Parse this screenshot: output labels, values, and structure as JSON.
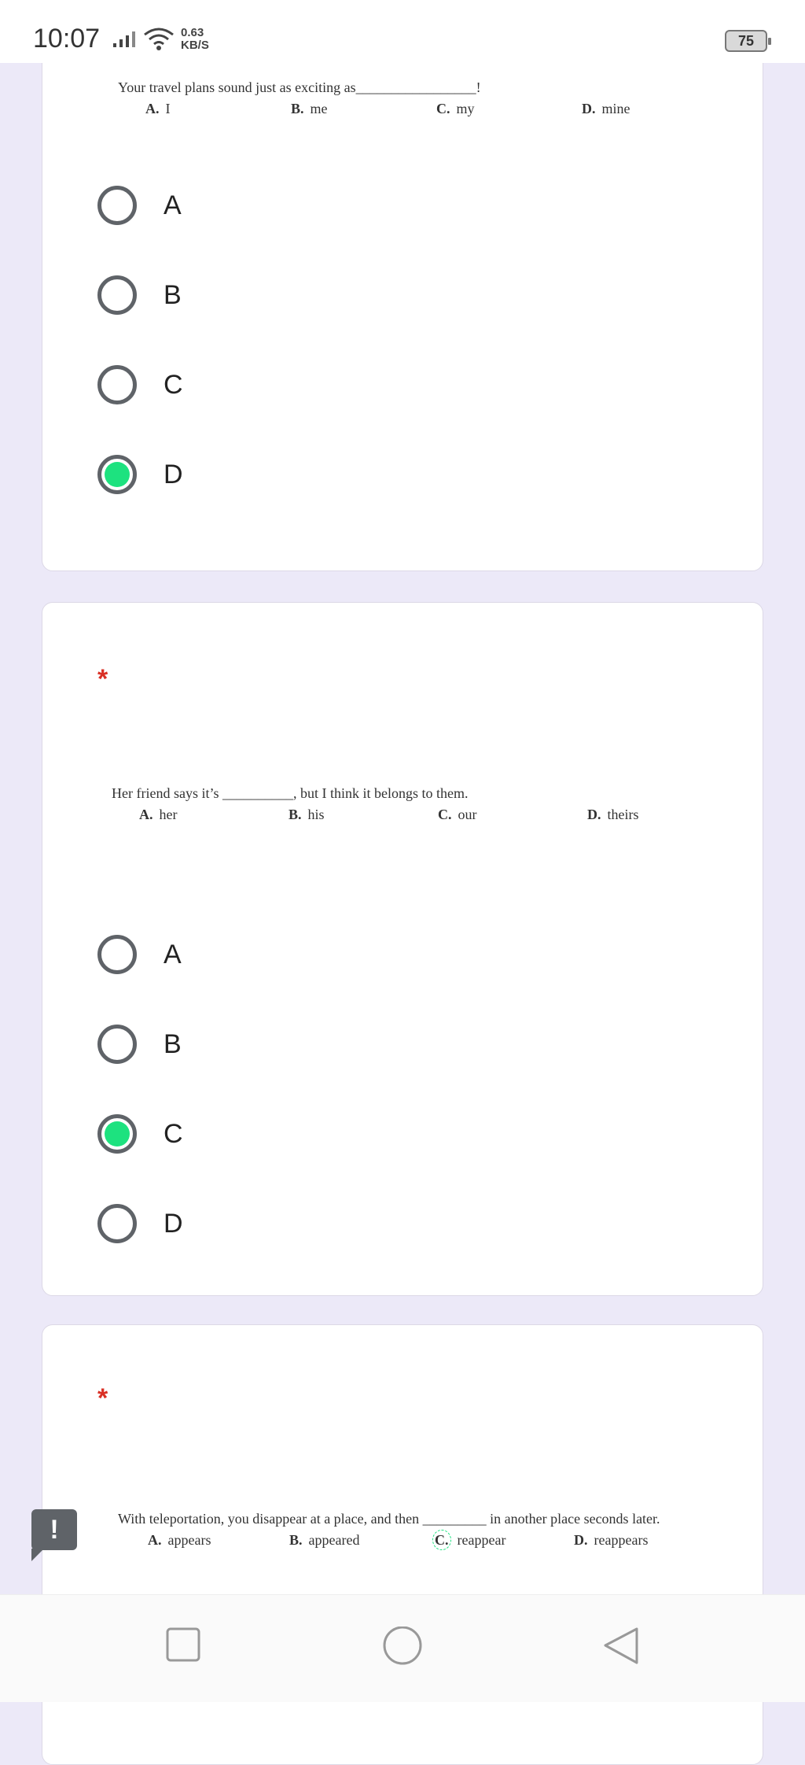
{
  "status_bar": {
    "time": "10:07",
    "network_speed": "0.63",
    "network_unit": "KB/S",
    "battery": "75"
  },
  "questions": [
    {
      "required_mark": "",
      "text": "Your travel plans sound just as exciting as_________________!",
      "image_options": [
        {
          "letter": "A.",
          "text": "I"
        },
        {
          "letter": "B.",
          "text": "me"
        },
        {
          "letter": "C.",
          "text": "my"
        },
        {
          "letter": "D.",
          "text": "mine"
        }
      ],
      "choices": [
        "A",
        "B",
        "C",
        "D"
      ],
      "selected": "D"
    },
    {
      "required_mark": "*",
      "text": "Her friend says it’s __________, but I think it belongs to them.",
      "image_options": [
        {
          "letter": "A.",
          "text": "her"
        },
        {
          "letter": "B.",
          "text": "his"
        },
        {
          "letter": "C.",
          "text": "our"
        },
        {
          "letter": "D.",
          "text": "theirs"
        }
      ],
      "choices": [
        "A",
        "B",
        "C",
        "D"
      ],
      "selected": "C"
    },
    {
      "required_mark": "*",
      "text": "With teleportation, you disappear at a place, and then _________ in another place seconds later.",
      "image_options": [
        {
          "letter": "A.",
          "text": "appears"
        },
        {
          "letter": "B.",
          "text": "appeared"
        },
        {
          "letter": "C.",
          "text": "reappear"
        },
        {
          "letter": "D.",
          "text": "reappears"
        }
      ]
    }
  ],
  "feedback_symbol": "!",
  "colors": {
    "selected_radio": "#1de27f",
    "required_star": "#d93025",
    "background": "#ece9f8"
  },
  "nav_icons": [
    "recent-apps-icon",
    "home-icon",
    "back-icon"
  ]
}
